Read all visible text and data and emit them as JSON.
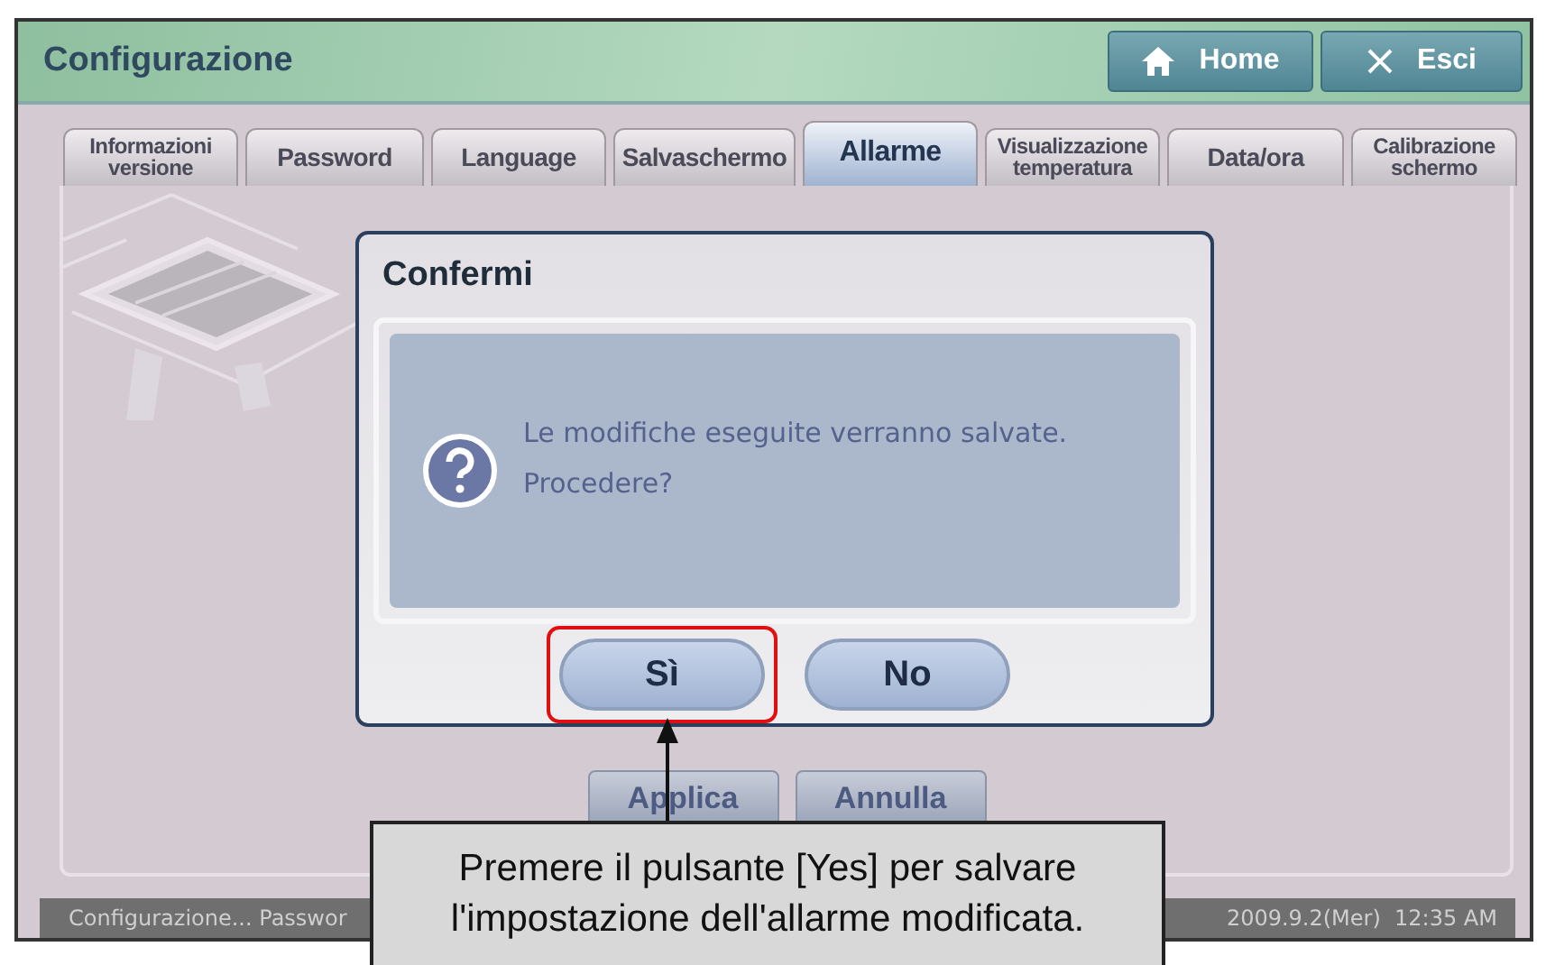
{
  "window": {
    "title": "Configurazione"
  },
  "header_buttons": [
    {
      "label": "Home",
      "kind": "home"
    },
    {
      "label": "Esci",
      "kind": "exit"
    }
  ],
  "tabs": [
    {
      "label": "Informazioni\nversione",
      "selected": false
    },
    {
      "label": "Password",
      "selected": false
    },
    {
      "label": "Language",
      "selected": false
    },
    {
      "label": "Salvaschermo",
      "selected": false
    },
    {
      "label": "Allarme",
      "selected": true
    },
    {
      "label": "Visualizzazione\ntemperatura",
      "selected": false
    },
    {
      "label": "Data/ora",
      "selected": false
    },
    {
      "label": "Calibrazione\nschermo",
      "selected": false
    }
  ],
  "dialog": {
    "title": "Confermi",
    "message": "Le modifiche eseguite verranno salvate.\nProcedere?",
    "buttons": [
      {
        "label": "Sì",
        "highlighted": true
      },
      {
        "label": "No",
        "highlighted": false
      }
    ]
  },
  "actions": [
    "Applica",
    "Annulla"
  ],
  "status_bar": {
    "left": "Configurazione... Passwor",
    "right": "2009.9.2(Mer)  12:35 AM"
  },
  "callout": {
    "text": "Premere il pulsante [Yes] per salvare\nl'impostazione dell'allarme modificata."
  }
}
